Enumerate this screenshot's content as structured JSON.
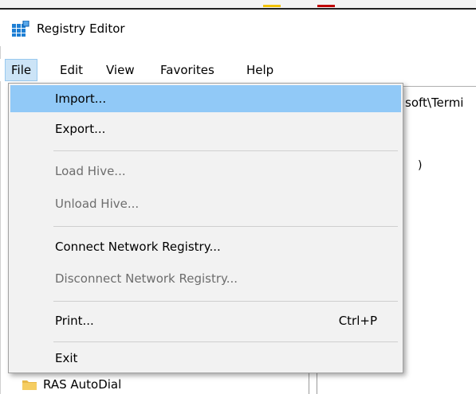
{
  "window": {
    "title": "Registry Editor"
  },
  "menubar": {
    "items": [
      {
        "label": "File",
        "active": true
      },
      {
        "label": "Edit",
        "active": false
      },
      {
        "label": "View",
        "active": false
      },
      {
        "label": "Favorites",
        "active": false
      },
      {
        "label": "Help",
        "active": false
      }
    ]
  },
  "file_menu": {
    "items": [
      {
        "label": "Import...",
        "enabled": true,
        "highlighted": true,
        "shortcut": ""
      },
      {
        "label": "Export...",
        "enabled": true,
        "highlighted": false,
        "shortcut": ""
      },
      {
        "label": "Load Hive...",
        "enabled": false,
        "highlighted": false,
        "shortcut": ""
      },
      {
        "label": "Unload Hive...",
        "enabled": false,
        "highlighted": false,
        "shortcut": ""
      },
      {
        "label": "Connect Network Registry...",
        "enabled": true,
        "highlighted": false,
        "shortcut": ""
      },
      {
        "label": "Disconnect Network Registry...",
        "enabled": false,
        "highlighted": false,
        "shortcut": ""
      },
      {
        "label": "Print...",
        "enabled": true,
        "highlighted": false,
        "shortcut": "Ctrl+P"
      },
      {
        "label": "Exit",
        "enabled": true,
        "highlighted": false,
        "shortcut": ""
      }
    ]
  },
  "background": {
    "address_fragment": "soft\\Termi",
    "value_fragment": ")",
    "tree_item": "RAS AutoDial"
  },
  "colors": {
    "menu_highlight": "#91c9f7",
    "menubar_active": "#cce4f7",
    "menu_bg": "#f2f2f2",
    "disabled_text": "#6d6d6d"
  },
  "icons": {
    "app": "registry-editor-icon",
    "folder": "folder-icon"
  }
}
